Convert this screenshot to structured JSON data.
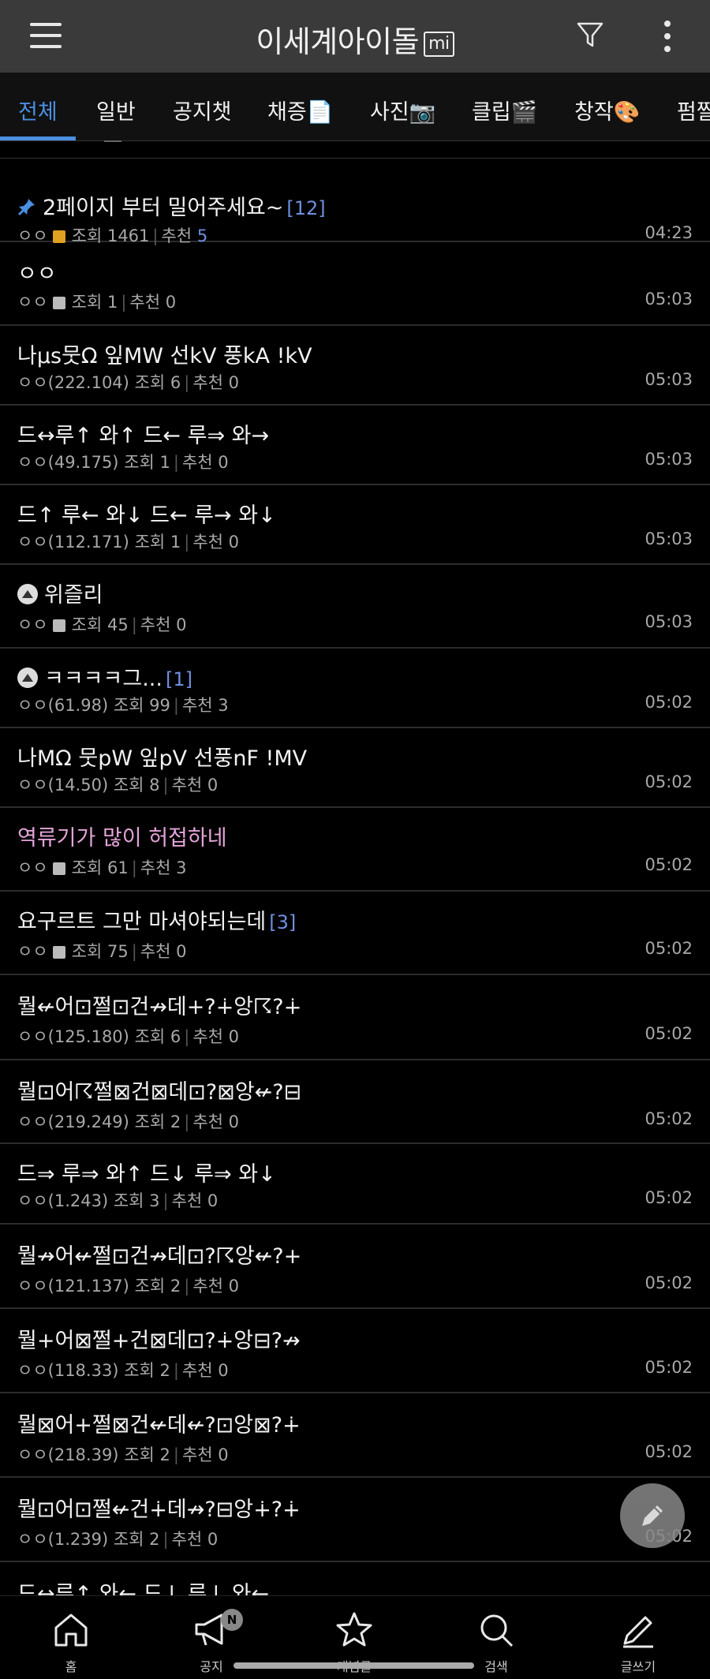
{
  "app": {
    "title": "이세계아이돌",
    "title_badge": "mi"
  },
  "tabs": [
    {
      "label": "전체",
      "active": true
    },
    {
      "label": "일반"
    },
    {
      "label": "공지챗"
    },
    {
      "label": "채증📄"
    },
    {
      "label": "사진📷"
    },
    {
      "label": "클립🎬"
    },
    {
      "label": "창작🎨"
    },
    {
      "label": "펌짤"
    }
  ],
  "posts": [
    {
      "title": "2페이지 부터 밀어주세요~",
      "count": "[12]",
      "author": "ㅇㅇ",
      "badge": "orange",
      "views_label": "조회 1461",
      "rec_label": "추천",
      "rec_value": "5",
      "time": "04:23",
      "pinned": true
    },
    {
      "title": "ㅇㅇ",
      "author": "ㅇㅇ",
      "badge": "gray",
      "views_label": "조회 1",
      "rec_label": "추천 0",
      "time": "05:03"
    },
    {
      "title": "나µs뭇Ω 잎MW 선kV 풍kA !kV",
      "author": "ㅇㅇ(222.104)",
      "views_label": "조회 6",
      "rec_label": "추천 0",
      "time": "05:03"
    },
    {
      "title": "드↔루↑ 와↑ 드← 루⇒ 와→",
      "author": "ㅇㅇ(49.175)",
      "views_label": "조회 1",
      "rec_label": "추천 0",
      "time": "05:03"
    },
    {
      "title": "드↑ 루← 와↓ 드← 루→ 와↓",
      "author": "ㅇㅇ(112.171)",
      "views_label": "조회 1",
      "rec_label": "추천 0",
      "time": "05:03"
    },
    {
      "title": "위즐리",
      "author": "ㅇㅇ",
      "badge": "gray",
      "views_label": "조회 45",
      "rec_label": "추천 0",
      "time": "05:03",
      "image": true
    },
    {
      "title": "ㅋㅋㅋㅋ그...",
      "count": "[1]",
      "author": "ㅇㅇ(61.98)",
      "views_label": "조회 99",
      "rec_label": "추천 3",
      "time": "05:02",
      "image": true
    },
    {
      "title": "나MΩ 뭇pW 잎pV 선풍nF !MV",
      "author": "ㅇㅇ(14.50)",
      "views_label": "조회 8",
      "rec_label": "추천 0",
      "time": "05:02"
    },
    {
      "title": "역류기가 많이 허접하네",
      "author": "ㅇㅇ",
      "badge": "gray",
      "views_label": "조회 61",
      "rec_label": "추천 3",
      "time": "05:02",
      "pink": true
    },
    {
      "title": "요구르트 그만 마셔야되는데",
      "count": "[3]",
      "author": "ㅇㅇ",
      "badge": "gray",
      "views_label": "조회 75",
      "rec_label": "추천 0",
      "time": "05:02"
    },
    {
      "title": "뭘↚어⊡쩔⊡건↛데+?∔앙☈?∔",
      "author": "ㅇㅇ(125.180)",
      "views_label": "조회 6",
      "rec_label": "추천 0",
      "time": "05:02"
    },
    {
      "title": "뭘⊡어☈쩔⊠건⊠데⊡?⊠앙↚?⊟",
      "author": "ㅇㅇ(219.249)",
      "views_label": "조회 2",
      "rec_label": "추천 0",
      "time": "05:02"
    },
    {
      "title": "드⇒ 루⇒ 와↑ 드↓ 루⇒ 와↓",
      "author": "ㅇㅇ(1.243)",
      "views_label": "조회 3",
      "rec_label": "추천 0",
      "time": "05:02"
    },
    {
      "title": "뭘↛어↚쩔⊡건↛데⊡?☈앙↚?+",
      "author": "ㅇㅇ(121.137)",
      "views_label": "조회 2",
      "rec_label": "추천 0",
      "time": "05:02"
    },
    {
      "title": "뭘+어⊠쩔+건⊠데⊡?∔앙⊟?↛",
      "author": "ㅇㅇ(118.33)",
      "views_label": "조회 2",
      "rec_label": "추천 0",
      "time": "05:02"
    },
    {
      "title": "뭘⊠어+쩔⊠건↚데↚?⊡앙⊠?∔",
      "author": "ㅇㅇ(218.39)",
      "views_label": "조회 2",
      "rec_label": "추천 0",
      "time": "05:02"
    },
    {
      "title": "뭘⊡어⊡쩔↚건∔데↛?⊟앙∔?∔",
      "author": "ㅇㅇ(1.239)",
      "views_label": "조회 2",
      "rec_label": "추천 0",
      "time": "05:02"
    },
    {
      "title": "드↔루↑ 와← 드↓ 루↓ 와←",
      "author": "",
      "views_label": "",
      "rec_label": "",
      "time": ""
    }
  ],
  "bottom_nav": [
    {
      "label": "홈",
      "icon": "home-icon"
    },
    {
      "label": "공지",
      "icon": "megaphone-icon",
      "badge": "N"
    },
    {
      "label": "개념글",
      "icon": "star-icon"
    },
    {
      "label": "검색",
      "icon": "search-icon"
    },
    {
      "label": "글쓰기",
      "icon": "pencil-icon"
    }
  ],
  "colors": {
    "accent": "#4a8fe0",
    "pink_title": "#e3a4d8",
    "topbar": "#3a3a3a"
  }
}
